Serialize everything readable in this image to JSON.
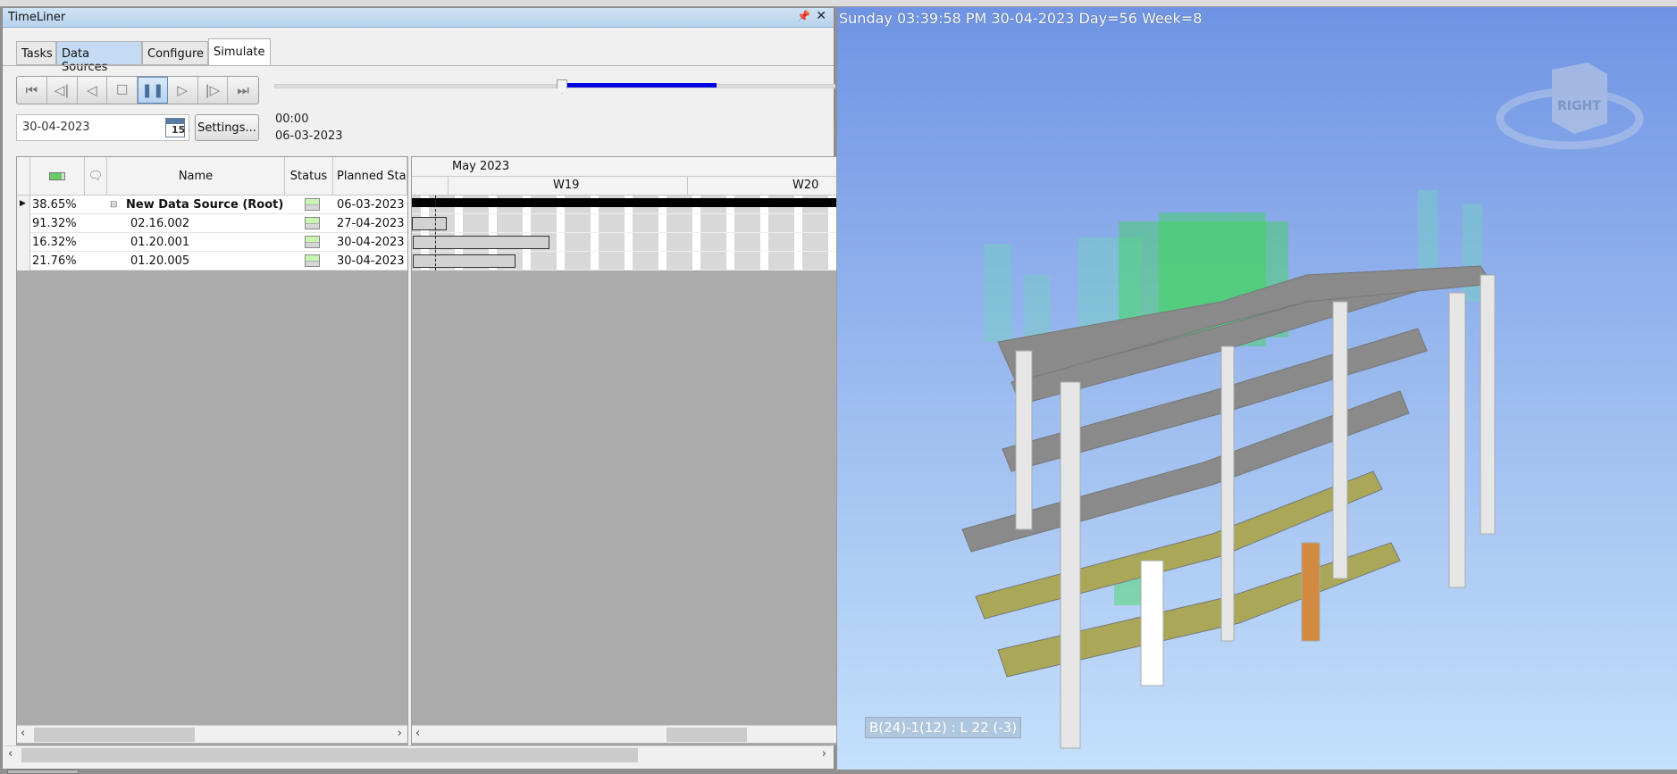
{
  "panel": {
    "title": "TimeLiner",
    "pin_icon": "pin-icon",
    "close_icon": "close-icon"
  },
  "tabs": [
    {
      "label": "Tasks"
    },
    {
      "label": "Data Sources"
    },
    {
      "label": "Configure"
    },
    {
      "label": "Simulate"
    }
  ],
  "active_tab": "Simulate",
  "playback": {
    "buttons": [
      "skip-to-start",
      "step-back",
      "play-reverse",
      "stop",
      "pause",
      "play",
      "step-forward",
      "skip-to-end"
    ],
    "active": "pause",
    "progress_percent": 38.65
  },
  "date_field": {
    "value": "30-04-2023",
    "calendar_day": "15"
  },
  "settings_label": "Settings...",
  "time_readout": {
    "time": "00:00",
    "date": "06-03-2023"
  },
  "table": {
    "columns": [
      "",
      "",
      "Name",
      "Status",
      "Planned Sta"
    ],
    "rows": [
      {
        "percent": "38.65%",
        "name": "New Data Source (Root)",
        "planned_start": "06-03-2023",
        "root": true
      },
      {
        "percent": "91.32%",
        "name": "02.16.002",
        "planned_start": "27-04-2023"
      },
      {
        "percent": "16.32%",
        "name": "01.20.001",
        "planned_start": "30-04-2023"
      },
      {
        "percent": "21.76%",
        "name": "01.20.005",
        "planned_start": "30-04-2023"
      }
    ]
  },
  "gantt": {
    "month": "May 2023",
    "weeks": [
      "W19",
      "W20"
    ]
  },
  "viewport": {
    "status_text": "Sunday 03:39:58 PM 30-04-2023 Day=56 Week=8",
    "viewcube_label": "RIGHT",
    "selection_label": "B(24)-1(12) : L 22 (-3)"
  },
  "colors": {
    "accent": "#0000e0",
    "progress_green": "#c9f5b2",
    "floor_olive": "#aaa858",
    "model_green": "#33dd44"
  }
}
